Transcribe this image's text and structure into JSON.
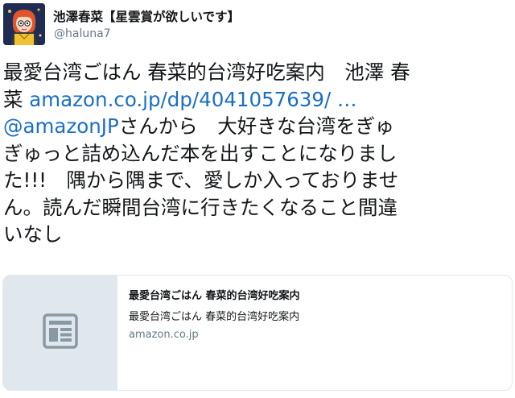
{
  "author": {
    "display_name": "池澤春菜【星雲賞が欲しいです】",
    "screen_name": "@haluna7",
    "avatar_icon": "user-avatar-icon"
  },
  "tweet": {
    "lines": [
      {
        "text": "最愛台湾ごはん 春菜的台湾好吃案内　池澤 春"
      },
      {
        "text": "菜 ",
        "link": "amazon.co.jp/dp/4041057639/ …"
      },
      {
        "link": "@amazonJP",
        "text": "さんから　大好きな台湾をぎゅ"
      },
      {
        "text": "ぎゅっと詰め込んだ本を出すことになりまし"
      },
      {
        "text": "た!!!　隅から隅まで、愛しか入っておりませ"
      },
      {
        "text": "ん。読んだ瞬間台湾に行きたくなること間違"
      },
      {
        "text": "いなし"
      }
    ]
  },
  "card": {
    "icon": "document-icon",
    "title": "最愛台湾ごはん 春菜的台湾好吃案内",
    "description": "最愛台湾ごはん 春菜的台湾好吃案内",
    "domain": "amazon.co.jp"
  },
  "colors": {
    "link": "#1b6fc4",
    "secondary_text": "#657786",
    "card_border": "#e1e8ed"
  }
}
